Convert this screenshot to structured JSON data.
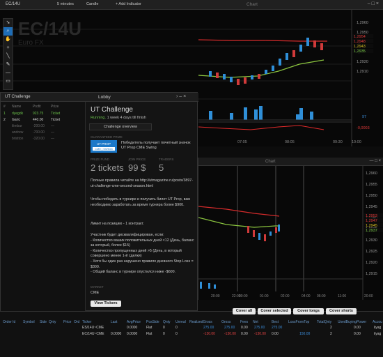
{
  "topbar": {
    "symbol": "EC/14U",
    "interval": "5 minutes",
    "type": "Candle",
    "add_indicator": "+ Add Indicator",
    "chart_title": "Chart"
  },
  "chart1": {
    "watermark_symbol": "EC/14U",
    "watermark_name": "Euro FX",
    "price_ticks": [
      "1,2960",
      "1,2950",
      "1,2940",
      "1,2930",
      "1,2920",
      "1,2910"
    ],
    "price_tags": [
      {
        "v": "1,2954",
        "c": "#e23a3a"
      },
      {
        "v": "1,2948",
        "c": "#e23a3a"
      },
      {
        "v": "1,2943",
        "c": "#d9c021"
      },
      {
        "v": "1,2935",
        "c": "#7fd34a"
      }
    ],
    "vol_tag": "97",
    "osc_tag": "-0,0003",
    "time_labels": [
      "07:05",
      "08:05",
      "09:30",
      "10:00"
    ],
    "colors": {
      "up": "#2f8fd8",
      "down": "#d13a3a",
      "ma_red": "#d42b2b",
      "ma_green": "#8cc63f"
    }
  },
  "chart2": {
    "title": "Chart",
    "price_ticks": [
      "1,2960",
      "1,2955",
      "1,2950",
      "1,2945",
      "1,2940",
      "1,2935",
      "1,2930",
      "1,2925",
      "1,2920",
      "1,2915"
    ],
    "price_tags": [
      {
        "v": "1,2953",
        "c": "#e23a3a"
      },
      {
        "v": "1,2947",
        "c": "#e23a3a"
      },
      {
        "v": "1,2945",
        "c": "#d9c021"
      },
      {
        "v": "1,2937",
        "c": "#7fd34a"
      }
    ],
    "time_labels": [
      "20:00",
      "22:00",
      "00:00",
      "01:00",
      "02:00",
      "04:00",
      "06:00",
      "11:00",
      "20:00"
    ]
  },
  "panel": {
    "tab_left": "UT Challenge",
    "tab_right": "Lobby",
    "leaderboard": {
      "headers": [
        "#",
        "Name",
        "Profit",
        "Prize"
      ],
      "rows": [
        {
          "rank": "1",
          "name": "rlyegdk",
          "profit": "923.75",
          "prize": "Ticket",
          "hl": true
        },
        {
          "rank": "2",
          "name": "Garic",
          "profit": "440.00",
          "prize": "Ticket",
          "hl": false
        },
        {
          "rank": "",
          "name": "ilimbar",
          "profit": "-200.00",
          "prize": "—",
          "hl": false
        },
        {
          "rank": "",
          "name": "andrew",
          "profit": "-700.00",
          "prize": "—",
          "hl": false
        },
        {
          "rank": "",
          "name": "bristton",
          "profit": "-320.00",
          "prize": "—",
          "hl": false
        }
      ]
    },
    "lobby": {
      "title": "UT Challenge",
      "status": "Running.",
      "status_detail": "1 week 4 days till finish",
      "overview_tab": "Challenge overview",
      "guaranteed_prize_label": "GUARANTEED PRIZE",
      "badge_top": "UT-PROP",
      "badge_bottom": "CME | SWING",
      "prize_desc": "Победитель получает почетный значок UT Prop CME Swing",
      "prize_fund_label": "PRIZE FUND",
      "prize_fund_value": "2 tickets",
      "join_price_label": "JOIN PRICE",
      "join_price_value": "99 $",
      "traders_label": "TRADERS",
      "traders_value": "5",
      "p1": "Полные правила читайте на http://utmagazine.ru/posts/3897-ut-challenge-cme-second-season.html",
      "p2": "Чтобы победить в турнире и получить билет UT Prop, вам необходимо заработать за время турнира более $900.",
      "p3": "Лимит на позицию - 1 контракт.",
      "p4": "Участник будет дисквалифицирован, если:\n- Количество ваших положительных дней <12 (День, баланс за который, более $15)\n- Количество пропущенных дней >5 (День, в который совершено менее 1-й сделки)\n- Хотя бы один раз нарушено правило дневного Stop Loss = $300.\n- Общий баланс в турнире опустился ниже -$600.",
      "market_label": "MARKET",
      "market_value": "CME",
      "view_tickers": "View Tickers"
    }
  },
  "orders": {
    "buttons": [
      "Cover all",
      "Cover selected",
      "Cover longs",
      "Cover shorts"
    ],
    "headers": [
      "Order Id",
      "Symbol",
      "Side",
      "Qnty",
      "Price",
      "Ord",
      "Ticker",
      "Last",
      "AvgPrice",
      "PosSide",
      "Qnty",
      "Unreal",
      "RealizedGross",
      "Gross",
      "Fees",
      "Net",
      "Best",
      "LossFromTop",
      "TotalQnty",
      "UsedBuyingPower",
      "Accou"
    ],
    "rows": [
      {
        "ticker": "ES/14U~CME",
        "last": "",
        "avg": "0.0000",
        "side": "Flat",
        "qnty": "0",
        "unreal": "0",
        "realized": "275.00",
        "gross": "275.00",
        "fees": "0.00",
        "net": "275.00",
        "best": "275.00",
        "loss": "",
        "total": "2",
        "used": "0.00",
        "acc": "ilyag",
        "neg": false
      },
      {
        "ticker": "EC/14U~CME",
        "last": "0.0000",
        "avg": "0.0000",
        "side": "Flat",
        "qnty": "0",
        "unreal": "0",
        "realized": "-130.00",
        "gross": "-130.00",
        "fees": "0.00",
        "net": "-130.00",
        "best": "0.00",
        "loss": "150.00",
        "total": "2",
        "used": "0.00",
        "acc": "ilyag",
        "neg": true
      }
    ]
  }
}
